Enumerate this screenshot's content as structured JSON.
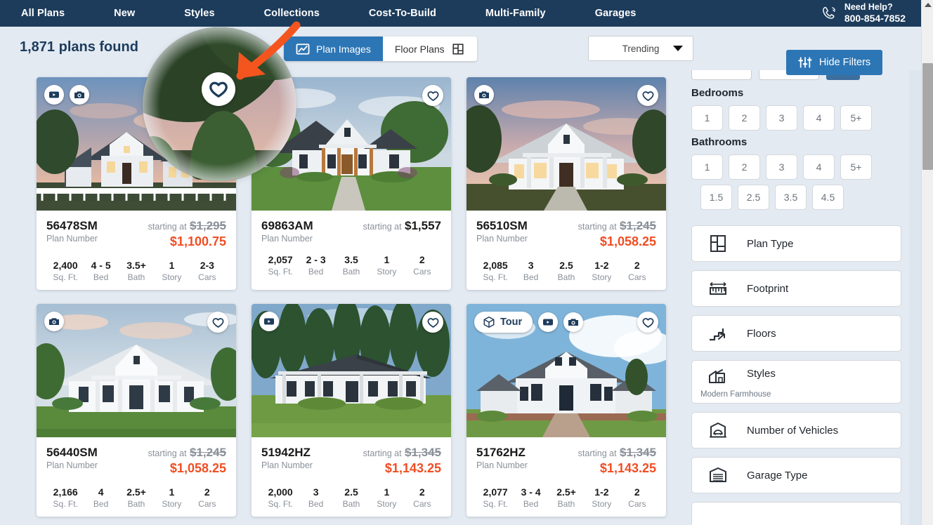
{
  "nav": {
    "items": [
      {
        "label": "All Plans",
        "name": "nav-all-plans"
      },
      {
        "label": "New",
        "name": "nav-new"
      },
      {
        "label": "Styles",
        "name": "nav-styles"
      },
      {
        "label": "Collections",
        "name": "nav-collections"
      },
      {
        "label": "Cost-To-Build",
        "name": "nav-cost-to-build"
      },
      {
        "label": "Multi-Family",
        "name": "nav-multi-family"
      },
      {
        "label": "Garages",
        "name": "nav-garages"
      }
    ],
    "help_label": "Need Help?",
    "help_phone": "800-854-7852",
    "phone_icon": "phone-icon",
    "background_color": "#1d3c5c"
  },
  "toolbar": {
    "results_count": "1,871 plans found",
    "view_toggle": [
      {
        "label": "Plan Images",
        "icon": "image-icon",
        "active": true
      },
      {
        "label": "Floor Plans",
        "icon": "floorplan-icon",
        "active": false
      }
    ],
    "sort": {
      "value": "Trending",
      "caret_icon": "chevron-down-icon"
    },
    "hide_filters": {
      "label": "Hide Filters",
      "icon": "sliders-icon",
      "color": "#2d76b5"
    }
  },
  "callout": {
    "arrow_color": "#f4551f",
    "magnified_icon": "heart-icon",
    "description": "magnifier-circle"
  },
  "cards": [
    {
      "plan_number": "56478SM",
      "plan_number_label": "Plan Number",
      "price_prefix": "starting at",
      "price_was": "$1,295",
      "price_now": "$1,100.75",
      "badges": [
        "video-icon",
        "camera-icon"
      ],
      "favorite": "heart-icon",
      "specs": [
        {
          "value": "2,400",
          "label": "Sq. Ft."
        },
        {
          "value": "4 - 5",
          "label": "Bed"
        },
        {
          "value": "3.5+",
          "label": "Bath"
        },
        {
          "value": "1",
          "label": "Story"
        },
        {
          "value": "2-3",
          "label": "Cars"
        }
      ]
    },
    {
      "plan_number": "69863AM",
      "plan_number_label": "Plan Number",
      "price_prefix": "starting at",
      "price_was": "",
      "price_plain": "$1,557",
      "price_now": "",
      "badges": [],
      "favorite": "heart-icon",
      "specs": [
        {
          "value": "2,057",
          "label": "Sq. Ft."
        },
        {
          "value": "2 - 3",
          "label": "Bed"
        },
        {
          "value": "3.5",
          "label": "Bath"
        },
        {
          "value": "1",
          "label": "Story"
        },
        {
          "value": "2",
          "label": "Cars"
        }
      ]
    },
    {
      "plan_number": "56510SM",
      "plan_number_label": "Plan Number",
      "price_prefix": "starting at",
      "price_was": "$1,245",
      "price_now": "$1,058.25",
      "badges": [
        "camera-icon"
      ],
      "favorite": "heart-icon",
      "specs": [
        {
          "value": "2,085",
          "label": "Sq. Ft."
        },
        {
          "value": "3",
          "label": "Bed"
        },
        {
          "value": "2.5",
          "label": "Bath"
        },
        {
          "value": "1-2",
          "label": "Story"
        },
        {
          "value": "2",
          "label": "Cars"
        }
      ]
    },
    {
      "plan_number": "56440SM",
      "plan_number_label": "Plan Number",
      "price_prefix": "starting at",
      "price_was": "$1,245",
      "price_now": "$1,058.25",
      "badges": [
        "camera-icon"
      ],
      "favorite": "heart-icon",
      "specs": [
        {
          "value": "2,166",
          "label": "Sq. Ft."
        },
        {
          "value": "4",
          "label": "Bed"
        },
        {
          "value": "2.5+",
          "label": "Bath"
        },
        {
          "value": "1",
          "label": "Story"
        },
        {
          "value": "2",
          "label": "Cars"
        }
      ]
    },
    {
      "plan_number": "51942HZ",
      "plan_number_label": "Plan Number",
      "price_prefix": "starting at",
      "price_was": "$1,345",
      "price_now": "$1,143.25",
      "badges": [
        "video-icon"
      ],
      "favorite": "heart-icon",
      "specs": [
        {
          "value": "2,000",
          "label": "Sq. Ft."
        },
        {
          "value": "3",
          "label": "Bed"
        },
        {
          "value": "2.5",
          "label": "Bath"
        },
        {
          "value": "1",
          "label": "Story"
        },
        {
          "value": "2",
          "label": "Cars"
        }
      ]
    },
    {
      "plan_number": "51762HZ",
      "plan_number_label": "Plan Number",
      "price_prefix": "starting at",
      "price_was": "$1,345",
      "price_now": "$1,143.25",
      "tour_label": "Tour",
      "badges": [
        "tour-pill",
        "video-icon",
        "camera-icon"
      ],
      "favorite": "heart-icon",
      "specs": [
        {
          "value": "2,077",
          "label": "Sq. Ft."
        },
        {
          "value": "3 - 4",
          "label": "Bed"
        },
        {
          "value": "2.5+",
          "label": "Bath"
        },
        {
          "value": "1-2",
          "label": "Story"
        },
        {
          "value": "2",
          "label": "Cars"
        }
      ]
    }
  ],
  "sidebar": {
    "bedrooms": {
      "title": "Bedrooms",
      "options": [
        "1",
        "2",
        "3",
        "4",
        "5+"
      ]
    },
    "bathrooms": {
      "title": "Bathrooms",
      "options": [
        "1",
        "2",
        "3",
        "4",
        "5+"
      ],
      "half_options": [
        "1.5",
        "2.5",
        "3.5",
        "4.5"
      ]
    },
    "filters": [
      {
        "label": "Plan Type",
        "icon": "plan-type-icon",
        "sub": ""
      },
      {
        "label": "Footprint",
        "icon": "ruler-icon",
        "sub": ""
      },
      {
        "label": "Floors",
        "icon": "stairs-icon",
        "sub": ""
      },
      {
        "label": "Styles",
        "icon": "house-style-icon",
        "sub": "Modern Farmhouse"
      },
      {
        "label": "Number of Vehicles",
        "icon": "vehicle-icon",
        "sub": ""
      },
      {
        "label": "Garage Type",
        "icon": "garage-icon",
        "sub": ""
      }
    ]
  }
}
